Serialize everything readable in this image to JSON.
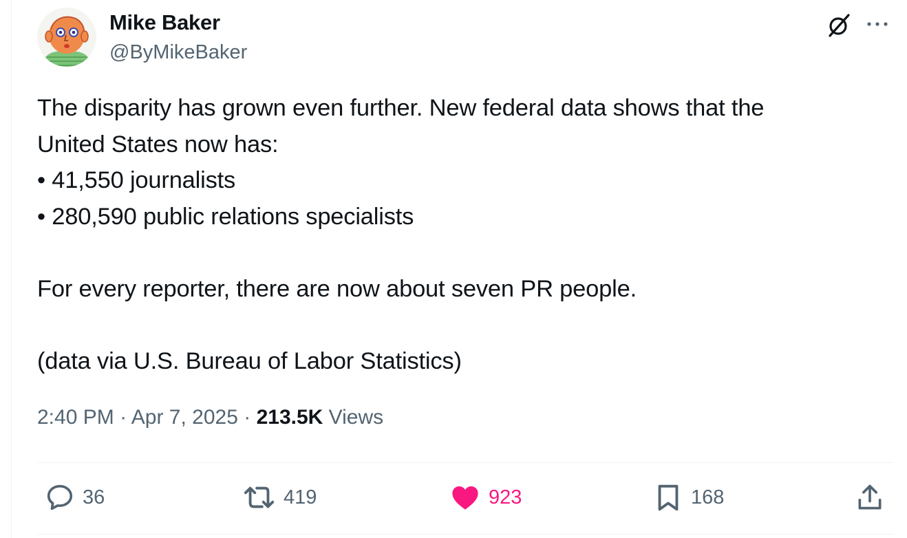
{
  "author": {
    "name": "Mike Baker",
    "handle": "@ByMikeBaker"
  },
  "tweet": {
    "lines": [
      "The disparity has grown even further. New federal data shows that the",
      "United States now has:",
      "• 41,550 journalists",
      "• 280,590 public relations specialists",
      "",
      "For every reporter, there are now about seven PR people.",
      "",
      "(data via U.S. Bureau of Labor Statistics)"
    ]
  },
  "meta": {
    "time": "2:40 PM",
    "date": "Apr 7, 2025",
    "separator": "·",
    "views_count": "213.5K",
    "views_label": "Views"
  },
  "actions": {
    "replies": "36",
    "reposts": "419",
    "likes": "923",
    "bookmarks": "168"
  },
  "icons": {
    "top_right": [
      "grok-icon",
      "more-icon"
    ],
    "actions": [
      "reply-icon",
      "repost-icon",
      "like-icon",
      "bookmark-icon",
      "share-icon"
    ]
  },
  "colors": {
    "text": "#0f1419",
    "secondary": "#536471",
    "like_active": "#f91880",
    "divider": "#eff3f4"
  }
}
